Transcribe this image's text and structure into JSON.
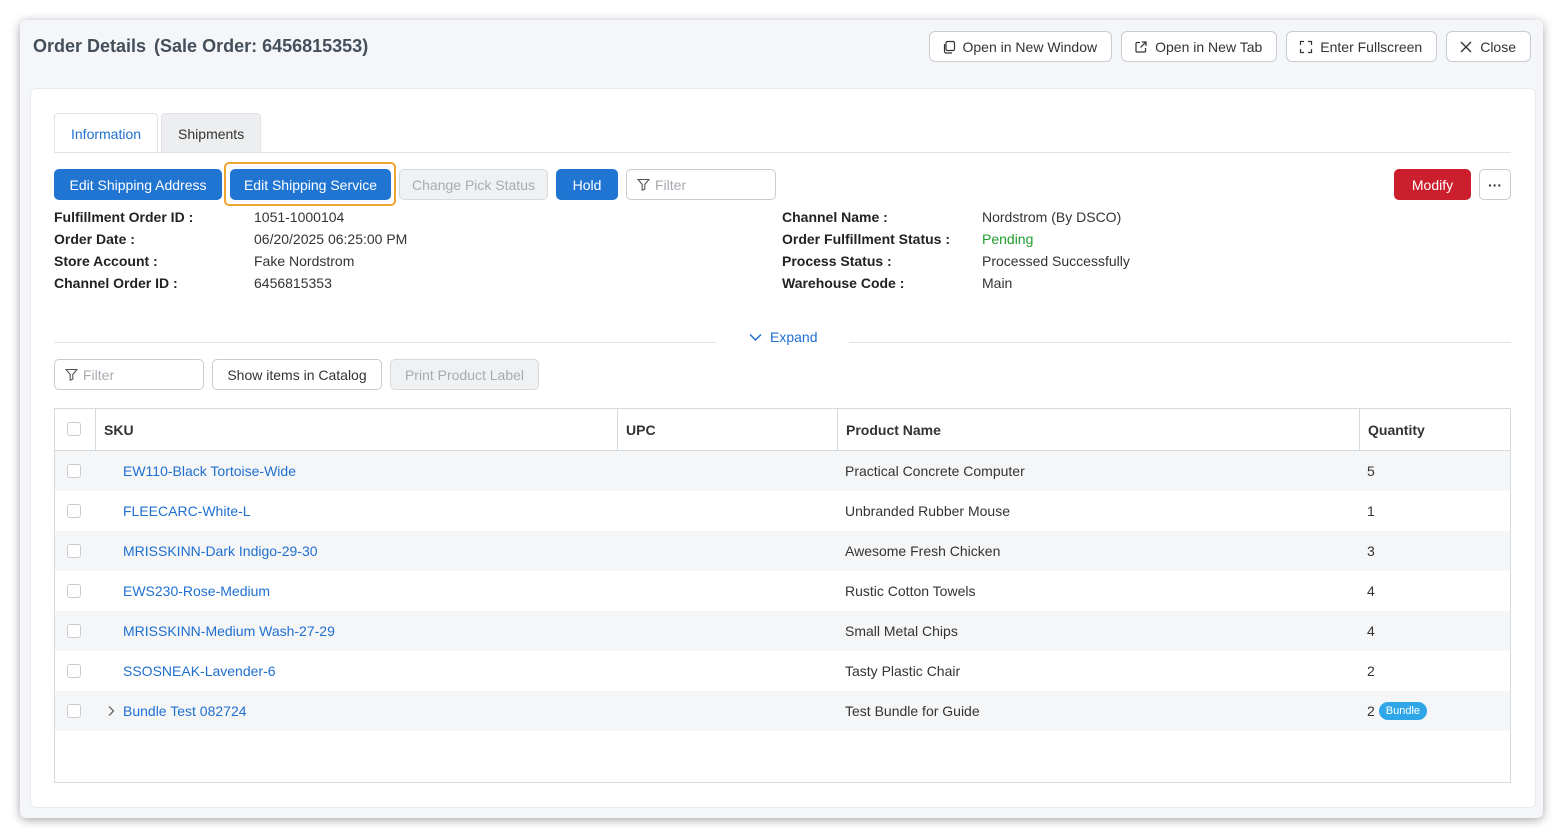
{
  "window": {
    "title": "Order Details",
    "subtitle": "(Sale Order: 6456815353)",
    "actions": [
      {
        "label": "Open in New Window",
        "icon": "copy-icon"
      },
      {
        "label": "Open in New Tab",
        "icon": "external-link-icon"
      },
      {
        "label": "Enter Fullscreen",
        "icon": "fullscreen-icon"
      },
      {
        "label": "Close",
        "icon": "close-icon"
      }
    ]
  },
  "tabs": [
    {
      "label": "Information",
      "active": true
    },
    {
      "label": "Shipments",
      "active": false
    }
  ],
  "toolbar": {
    "edit_address": "Edit Shipping Address",
    "edit_service": "Edit Shipping Service",
    "change_pick": "Change Pick Status",
    "hold": "Hold",
    "filter_placeholder": "Filter",
    "modify": "Modify",
    "more": "···"
  },
  "info_left": [
    {
      "label": "Fulfillment Order ID :",
      "value": "1051-1000104"
    },
    {
      "label": "Order Date :",
      "value": "06/20/2025 06:25:00 PM"
    },
    {
      "label": "Store Account :",
      "value": "Fake Nordstrom"
    },
    {
      "label": "Channel Order ID :",
      "value": "6456815353"
    }
  ],
  "info_right": [
    {
      "label": "Channel Name :",
      "value": "Nordstrom (By DSCO)"
    },
    {
      "label": "Order Fulfillment Status :",
      "value": "Pending"
    },
    {
      "label": "Process Status :",
      "value": "Processed Successfully"
    },
    {
      "label": "Warehouse Code :",
      "value": "Main"
    }
  ],
  "expand_label": "Expand",
  "items_toolbar": {
    "filter_placeholder": "Filter",
    "show_catalog": "Show items in Catalog",
    "print_label": "Print Product Label"
  },
  "table": {
    "columns": [
      "SKU",
      "UPC",
      "Product Name",
      "Quantity"
    ],
    "rows": [
      {
        "sku": "EW110-Black Tortoise-Wide",
        "upc": "",
        "name": "Practical Concrete Computer",
        "qty": "5"
      },
      {
        "sku": "FLEECARC-White-L",
        "upc": "",
        "name": "Unbranded Rubber Mouse",
        "qty": "1"
      },
      {
        "sku": "MRISSKINN-Dark Indigo-29-30",
        "upc": "",
        "name": "Awesome Fresh Chicken",
        "qty": "3"
      },
      {
        "sku": "EWS230-Rose-Medium",
        "upc": "",
        "name": "Rustic Cotton Towels",
        "qty": "4"
      },
      {
        "sku": "MRISSKINN-Medium Wash-27-29",
        "upc": "",
        "name": "Small Metal Chips",
        "qty": "4"
      },
      {
        "sku": "SSOSNEAK-Lavender-6",
        "upc": "",
        "name": "Tasty Plastic Chair",
        "qty": "2"
      },
      {
        "sku": "Bundle Test 082724",
        "upc": "",
        "name": "Test Bundle for Guide",
        "qty": "2",
        "badge": "Bundle",
        "expandable": true
      }
    ]
  },
  "colors": {
    "primary": "#1f75d1",
    "danger": "#cc1f2e",
    "highlight": "#f0a431",
    "pending": "#1e9e2c",
    "badge": "#2fa6e8"
  }
}
